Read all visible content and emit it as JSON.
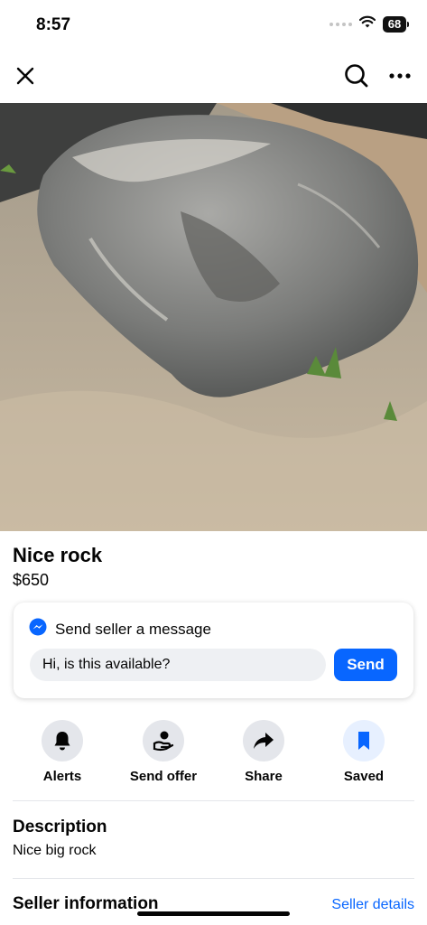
{
  "status_bar": {
    "time": "8:57",
    "battery": "68",
    "icons": [
      "signal-dots-icon",
      "wifi-icon",
      "battery-icon"
    ]
  },
  "nav": {
    "close_icon": "close-icon",
    "search_icon": "search-icon",
    "more_icon": "more-icon"
  },
  "photo": {
    "alt": "Large grey boulder on sandy ground"
  },
  "listing": {
    "title": "Nice rock",
    "price": "$650"
  },
  "message": {
    "header": "Send seller a message",
    "icon": "messenger-icon",
    "input_value": "Hi, is this available?",
    "send_label": "Send"
  },
  "actions": [
    {
      "label": "Alerts",
      "icon": "bell-icon"
    },
    {
      "label": "Send offer",
      "icon": "offer-hand-icon"
    },
    {
      "label": "Share",
      "icon": "share-arrow-icon"
    },
    {
      "label": "Saved",
      "icon": "bookmark-icon",
      "active": true
    }
  ],
  "description": {
    "heading": "Description",
    "text": "Nice big rock"
  },
  "seller": {
    "heading": "Seller information",
    "link": "Seller details"
  },
  "colors": {
    "accent": "#0866ff",
    "action_bg": "#e4e6eb",
    "saved_bg": "#e7f0ff"
  }
}
